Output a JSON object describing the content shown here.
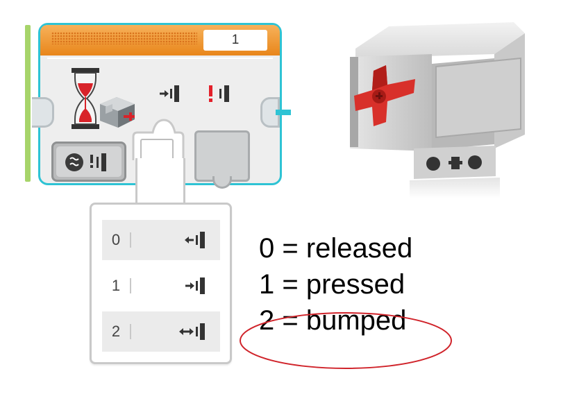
{
  "wait_block": {
    "port": "1",
    "inputs": [
      "released",
      "changed"
    ],
    "mode_icons": [
      "compare-icon",
      "changed-icon"
    ]
  },
  "state_dropdown": {
    "options": [
      {
        "value": "0",
        "icon": "released-icon"
      },
      {
        "value": "1",
        "icon": "pressed-icon"
      },
      {
        "value": "2",
        "icon": "bumped-icon"
      }
    ]
  },
  "legend": {
    "lines": [
      "0 = released",
      "1 = pressed",
      "2 = bumped"
    ],
    "highlighted_line": "2 = bumped",
    "highlight_color": "#d0232a"
  },
  "colors": {
    "block_header": "#f0a040",
    "block_border": "#2ec3d4",
    "sensor_button": "#d8302a"
  }
}
